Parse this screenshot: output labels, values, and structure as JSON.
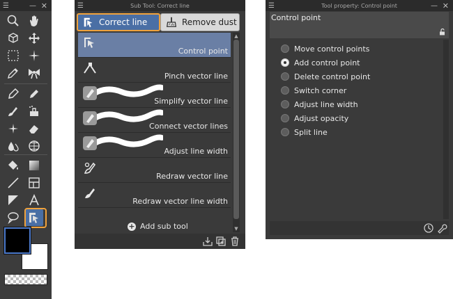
{
  "tool_palette": {
    "tools": [
      {
        "name": "zoom-icon"
      },
      {
        "name": "hand-icon"
      },
      {
        "name": "operation-icon"
      },
      {
        "name": "move-layer-icon"
      },
      {
        "name": "selection-icon"
      },
      {
        "name": "auto-select-icon"
      },
      {
        "name": "eyedropper-icon"
      },
      {
        "name": "ribbon-icon"
      },
      {
        "name": "pen-icon"
      },
      {
        "name": "pencil-icon"
      },
      {
        "name": "brush-icon"
      },
      {
        "name": "airbrush-icon"
      },
      {
        "name": "decoration-icon"
      },
      {
        "name": "eraser-icon"
      },
      {
        "name": "blend-icon"
      },
      {
        "name": "grid-icon"
      },
      {
        "name": "fill-icon"
      },
      {
        "name": "gradient-icon"
      },
      {
        "name": "figure-icon"
      },
      {
        "name": "frame-border-icon"
      },
      {
        "name": "balloon-icon"
      },
      {
        "name": "text-icon"
      },
      {
        "name": "lasso-icon"
      },
      {
        "name": "correct-line-icon"
      }
    ],
    "main_color": "#000000",
    "sub_color": "#ffffff",
    "highlight_color": "#f0a23c"
  },
  "subtool": {
    "title": "Sub Tool: Correct line",
    "tabs": [
      {
        "label": "Correct line",
        "active": true
      },
      {
        "label": "Remove dust",
        "active": false
      }
    ],
    "items": [
      {
        "label": "Control point",
        "selected": true
      },
      {
        "label": "Pinch vector line",
        "selected": false
      },
      {
        "label": "Simplify vector line",
        "selected": false
      },
      {
        "label": "Connect vector lines",
        "selected": false
      },
      {
        "label": "Adjust line width",
        "selected": false
      },
      {
        "label": "Redraw vector line",
        "selected": false
      },
      {
        "label": "Redraw vector line width",
        "selected": false
      }
    ],
    "add_label": "Add sub tool"
  },
  "toolprop": {
    "title": "Tool property: Control point",
    "header_name": "Control point",
    "options": [
      {
        "label": "Move control points",
        "checked": false
      },
      {
        "label": "Add control point",
        "checked": true
      },
      {
        "label": "Delete control point",
        "checked": false
      },
      {
        "label": "Switch corner",
        "checked": false
      },
      {
        "label": "Adjust line width",
        "checked": false
      },
      {
        "label": "Adjust opacity",
        "checked": false
      },
      {
        "label": "Split line",
        "checked": false
      }
    ]
  },
  "window_controls": {
    "menu": "☰",
    "minimize": "—",
    "close": "✕"
  }
}
